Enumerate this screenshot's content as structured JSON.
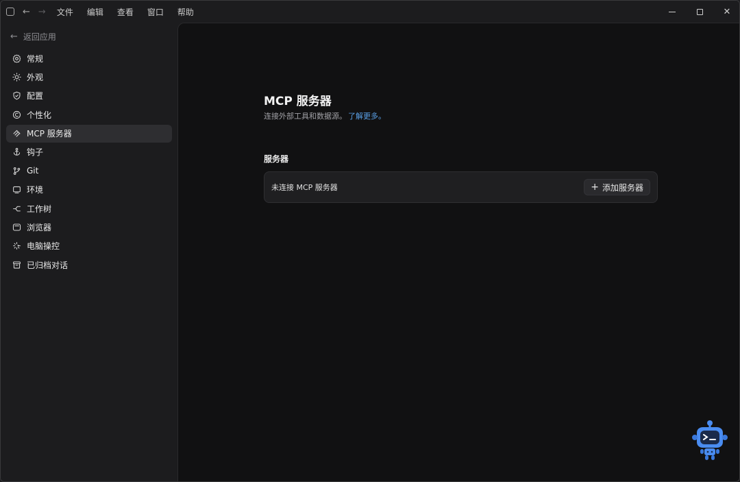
{
  "titlebar": {
    "menu": [
      "文件",
      "编辑",
      "查看",
      "窗口",
      "帮助"
    ]
  },
  "sidebar": {
    "back_label": "返回应用",
    "items": [
      {
        "label": "常规",
        "icon": "gear-icon"
      },
      {
        "label": "外观",
        "icon": "sun-icon"
      },
      {
        "label": "配置",
        "icon": "shield-icon"
      },
      {
        "label": "个性化",
        "icon": "personalize-icon"
      },
      {
        "label": "MCP 服务器",
        "icon": "mcp-icon",
        "active": true
      },
      {
        "label": "钩子",
        "icon": "anchor-icon"
      },
      {
        "label": "Git",
        "icon": "git-branch-icon"
      },
      {
        "label": "环境",
        "icon": "monitor-icon"
      },
      {
        "label": "工作树",
        "icon": "worktree-icon"
      },
      {
        "label": "浏览器",
        "icon": "browser-icon"
      },
      {
        "label": "电脑操控",
        "icon": "sparkle-icon"
      },
      {
        "label": "已归档对话",
        "icon": "archive-icon"
      }
    ]
  },
  "main": {
    "title": "MCP 服务器",
    "subtitle": "连接外部工具和数据源。",
    "subtitle_link": "了解更多。",
    "section_title": "服务器",
    "empty_text": "未连接 MCP 服务器",
    "add_button": "添加服务器"
  },
  "colors": {
    "accent_link": "#5aa0e6",
    "main_bg": "#111112",
    "sidebar_bg": "#1c1c1e",
    "mascot": "#4a8cf0"
  }
}
